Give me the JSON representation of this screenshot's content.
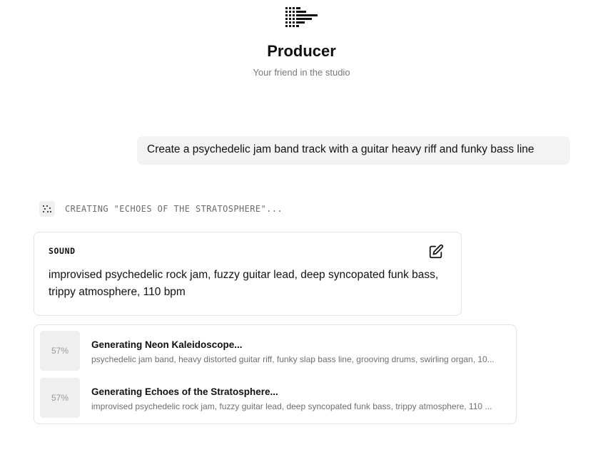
{
  "app": {
    "title": "Producer",
    "subtitle": "Your friend in the studio",
    "logo_icon": "arrow-logo-icon"
  },
  "conversation": {
    "user_message": "Create a psychedelic jam band track with a guitar heavy riff and funky bass line",
    "status_icon": "dots-loading-icon",
    "status_text": "CREATING \"ECHOES OF THE STRATOSPHERE\"..."
  },
  "sound_card": {
    "label": "SOUND",
    "edit_icon": "edit-icon",
    "description": "improvised psychedelic rock jam, fuzzy guitar lead, deep syncopated funk bass, trippy atmosphere, 110 bpm"
  },
  "tracks": [
    {
      "progress": "57%",
      "title": "Generating Neon Kaleidoscope...",
      "description": "psychedelic jam band, heavy distorted guitar riff, funky slap bass line, grooving drums, swirling organ, 10..."
    },
    {
      "progress": "57%",
      "title": "Generating Echoes of the Stratosphere...",
      "description": "improvised psychedelic rock jam, fuzzy guitar lead, deep syncopated funk bass, trippy atmosphere, 110 ..."
    }
  ],
  "colors": {
    "text": "#111111",
    "muted": "#777777",
    "bubble": "#f3f3f3",
    "border": "#e4e4e4",
    "placeholder": "#efefef"
  }
}
